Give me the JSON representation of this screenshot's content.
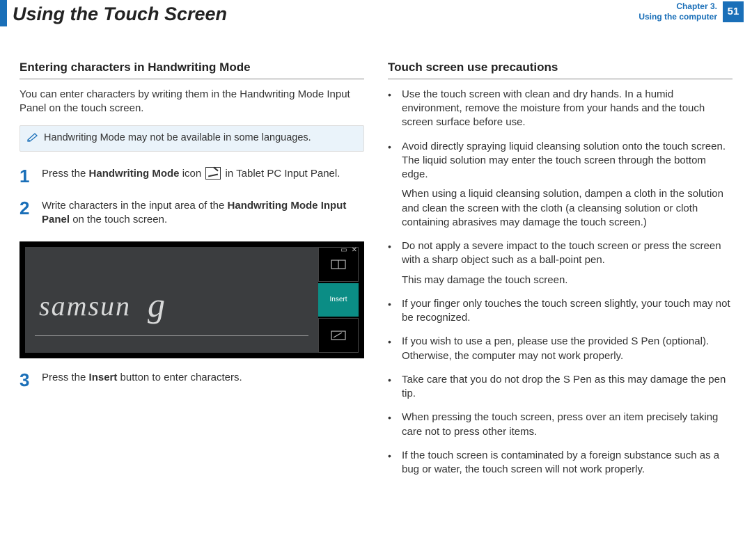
{
  "header": {
    "title": "Using the Touch Screen",
    "chapter_line1": "Chapter 3.",
    "chapter_line2": "Using the computer",
    "page_number": "51"
  },
  "left": {
    "heading": "Entering characters in Handwriting Mode",
    "intro": "You can enter characters by writing them in the Handwriting Mode Input Panel on the touch screen.",
    "note": "Handwriting Mode may not be available in some languages.",
    "steps": {
      "s1_a": "Press the ",
      "s1_b": "Handwriting Mode",
      "s1_c": " icon ",
      "s1_d": " in Tablet PC Input Panel.",
      "s2_a": "Write characters in the input area of the ",
      "s2_b": "Handwriting Mode Input Panel",
      "s2_c": " on the touch screen.",
      "s3_a": "Press the ",
      "s3_b": "Insert",
      "s3_c": " button to enter characters."
    },
    "panel": {
      "sample_text": "samsun",
      "sample_tail": "g",
      "insert_label": "Insert"
    }
  },
  "right": {
    "heading": "Touch screen use precautions",
    "items": [
      "Use the touch screen with clean and dry hands. In a humid environment, remove the moisture from your hands and the touch screen surface before use.",
      "Avoid directly spraying liquid cleansing solution onto the touch screen. The liquid solution may enter the touch screen through the bottom edge.",
      "When using a liquid cleansing solution, dampen a cloth in the solution and clean the screen with the cloth (a cleansing solution or cloth containing abrasives may damage the touch screen.)",
      "Do not apply a severe impact to the touch screen or press the screen with a sharp object such as a ball-point pen.",
      "This may damage the touch screen.",
      "If your finger only touches the touch screen slightly, your touch may not be recognized.",
      "If you wish to use a pen, please use the provided S Pen (optional). Otherwise, the computer may not work properly.",
      "Take care that you do not drop the S Pen as this may damage the pen tip.",
      "When pressing the touch screen, press over an item precisely taking care not to press other items.",
      "If the touch screen is contaminated by a foreign substance such as a bug or water, the touch screen will not work properly."
    ]
  }
}
